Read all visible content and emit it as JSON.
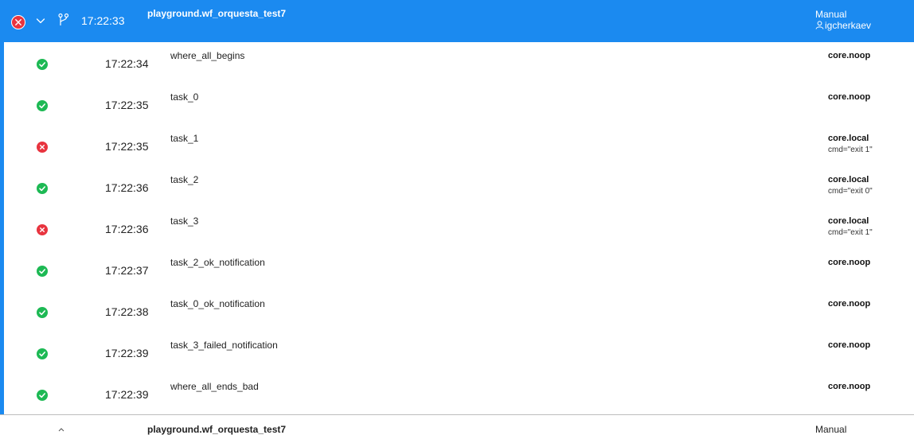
{
  "header": {
    "status": "failed",
    "time": "17:22:33",
    "workflow": "playground.wf_orquesta_test7",
    "run_type": "Manual",
    "user": "igcherkaev"
  },
  "tasks": [
    {
      "status": "succeeded",
      "time": "17:22:34",
      "name": "where_all_begins",
      "action": "core.noop",
      "params": ""
    },
    {
      "status": "succeeded",
      "time": "17:22:35",
      "name": "task_0",
      "action": "core.noop",
      "params": ""
    },
    {
      "status": "failed",
      "time": "17:22:35",
      "name": "task_1",
      "action": "core.local",
      "params": "cmd=\"exit 1\""
    },
    {
      "status": "succeeded",
      "time": "17:22:36",
      "name": "task_2",
      "action": "core.local",
      "params": "cmd=\"exit 0\""
    },
    {
      "status": "failed",
      "time": "17:22:36",
      "name": "task_3",
      "action": "core.local",
      "params": "cmd=\"exit 1\""
    },
    {
      "status": "succeeded",
      "time": "17:22:37",
      "name": "task_2_ok_notification",
      "action": "core.noop",
      "params": ""
    },
    {
      "status": "succeeded",
      "time": "17:22:38",
      "name": "task_0_ok_notification",
      "action": "core.noop",
      "params": ""
    },
    {
      "status": "succeeded",
      "time": "17:22:39",
      "name": "task_3_failed_notification",
      "action": "core.noop",
      "params": ""
    },
    {
      "status": "succeeded",
      "time": "17:22:39",
      "name": "where_all_ends_bad",
      "action": "core.noop",
      "params": ""
    }
  ],
  "next_execution": {
    "workflow": "playground.wf_orquesta_test7",
    "run_type": "Manual"
  },
  "colors": {
    "accent": "#1b8af0",
    "success": "#1db954",
    "failure": "#e8343f"
  },
  "icons": {
    "succeeded": "check-circle-icon",
    "failed": "x-circle-icon",
    "expand": "chevron-down-icon",
    "branch": "branch-icon",
    "user": "user-icon"
  }
}
